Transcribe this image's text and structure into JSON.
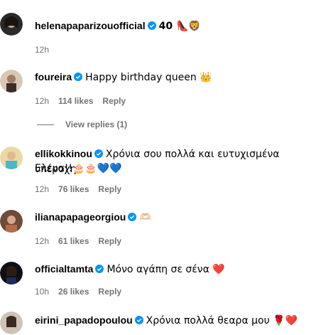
{
  "comments": [
    {
      "username": "helenapaparizouofficial",
      "text": "40 👠🦁",
      "time": "12h",
      "likes": "",
      "reply": ""
    },
    {
      "username": "foureira",
      "text": "Happy birthday queen 👑",
      "time": "12h",
      "likes": "114 likes",
      "reply": "Reply"
    },
    {
      "username": "ellikokkinou",
      "text": "Χρόνια σου πολλά και ευτυχισμένα υπέροχη",
      "text2": "Ελενα!!🎂🎂💙💙",
      "time": "12h",
      "likes": "76 likes",
      "reply": "Reply"
    },
    {
      "username": "ilianapapageorgiou",
      "text": "🫶🏻",
      "time": "12h",
      "likes": "61 likes",
      "reply": "Reply"
    },
    {
      "username": "officialtamta",
      "text": "Μόνο αγάπη σε σένα ❤️",
      "time": "10h",
      "likes": "26 likes",
      "reply": "Reply"
    },
    {
      "username": "eirini_papadopoulou",
      "text": "Χρόνια πολλά θεαρα μου 🌹❤️",
      "time": "",
      "likes": "",
      "reply": ""
    }
  ],
  "view_replies": "View replies (1)",
  "colors": {
    "verified": "#0095f6",
    "muted": "#737373"
  }
}
